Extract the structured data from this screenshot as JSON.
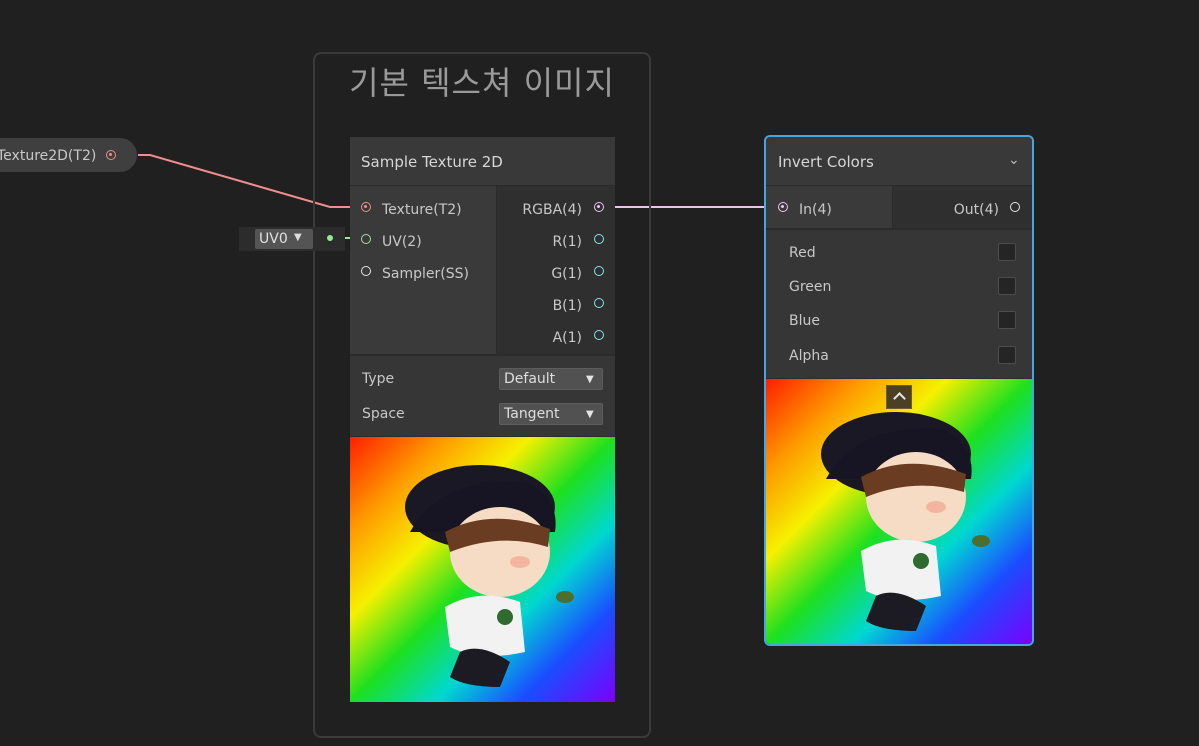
{
  "group": {
    "title": "기본 텍스쳐 이미지"
  },
  "property_node": {
    "label": "Texture2D(T2)"
  },
  "uv_input": {
    "value": "UV0"
  },
  "sample_texture_node": {
    "title": "Sample Texture 2D",
    "inputs": [
      "Texture(T2)",
      "UV(2)",
      "Sampler(SS)"
    ],
    "outputs": [
      "RGBA(4)",
      "R(1)",
      "G(1)",
      "B(1)",
      "A(1)"
    ],
    "settings": {
      "type_label": "Type",
      "type_value": "Default",
      "space_label": "Space",
      "space_value": "Tangent"
    }
  },
  "invert_node": {
    "title": "Invert Colors",
    "input": "In(4)",
    "output": "Out(4)",
    "channels": [
      "Red",
      "Green",
      "Blue",
      "Alpha"
    ],
    "channels_checked": [
      false,
      false,
      false,
      false
    ]
  },
  "colors": {
    "background": "#202020",
    "texture_wire": "#f08d8d",
    "vector4_wire": "#f0c0ef",
    "vector2_wire": "#9be59b",
    "vector1_port": "#84e4e4",
    "selection_outline": "#44a7e3"
  },
  "icons": {
    "dropdown": "caret-down-icon",
    "node_menu": "chevron-down-icon",
    "collapse": "chevron-up-icon"
  }
}
